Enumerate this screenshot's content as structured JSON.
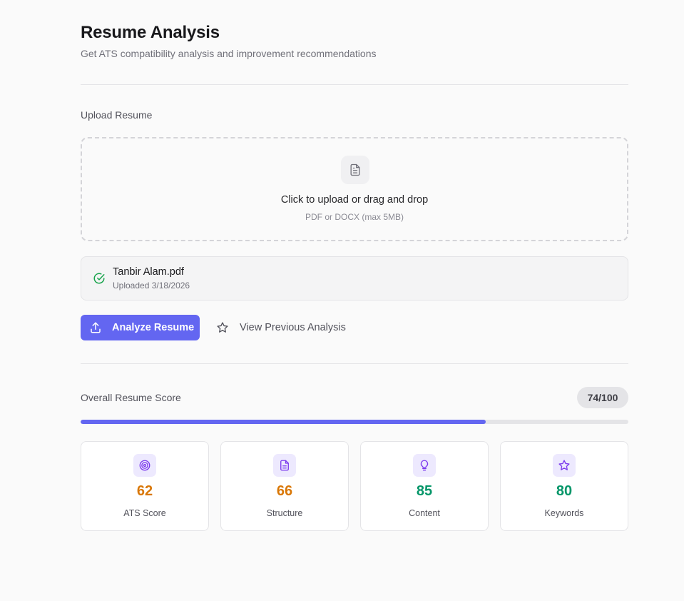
{
  "header": {
    "title": "Resume Analysis",
    "subtitle": "Get ATS compatibility analysis and improvement recommendations"
  },
  "upload": {
    "section_label": "Upload Resume",
    "dropzone_icon": "file-text-icon",
    "dropzone_title": "Click to upload or drag and drop",
    "dropzone_hint": "PDF or DOCX (max 5MB)"
  },
  "file": {
    "status_icon": "check-circle-icon",
    "name": "Tanbir Alam.pdf",
    "uploaded": "Uploaded 3/18/2026"
  },
  "actions": {
    "analyze_label": "Analyze Resume",
    "analyze_icon": "upload-icon",
    "previous_label": "View Previous Analysis",
    "previous_icon": "star-icon"
  },
  "score": {
    "label": "Overall Resume Score",
    "badge": "74/100",
    "progress_percent": 74
  },
  "metrics": [
    {
      "value": "62",
      "label": "ATS Score",
      "icon": "target-icon",
      "tone": "orange"
    },
    {
      "value": "66",
      "label": "Structure",
      "icon": "file-text-icon",
      "tone": "orange"
    },
    {
      "value": "85",
      "label": "Content",
      "icon": "lightbulb-icon",
      "tone": "green"
    },
    {
      "value": "80",
      "label": "Keywords",
      "icon": "star-icon",
      "tone": "green"
    }
  ],
  "colors": {
    "accent": "#6366f1",
    "orange": "#d97706",
    "green": "#059669",
    "icon_bg": "#ede9fe",
    "icon_stroke": "#7c3aed",
    "check": "#16a34a"
  }
}
